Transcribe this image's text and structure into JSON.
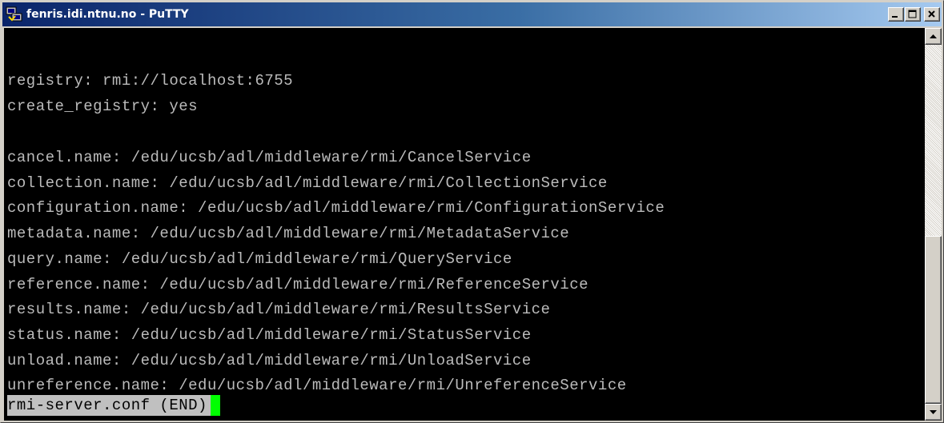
{
  "window": {
    "title": "fenris.idi.ntnu.no - PuTTY",
    "icon": "putty-icon",
    "controls": [
      "minimize-icon",
      "maximize-icon",
      "close-icon"
    ]
  },
  "terminal": {
    "lines": [
      "",
      "registry: rmi://localhost:6755",
      "create_registry: yes",
      "",
      "cancel.name: /edu/ucsb/adl/middleware/rmi/CancelService",
      "collection.name: /edu/ucsb/adl/middleware/rmi/CollectionService",
      "configuration.name: /edu/ucsb/adl/middleware/rmi/ConfigurationService",
      "metadata.name: /edu/ucsb/adl/middleware/rmi/MetadataService",
      "query.name: /edu/ucsb/adl/middleware/rmi/QueryService",
      "reference.name: /edu/ucsb/adl/middleware/rmi/ReferenceService",
      "results.name: /edu/ucsb/adl/middleware/rmi/ResultsService",
      "status.name: /edu/ucsb/adl/middleware/rmi/StatusService",
      "unload.name: /edu/ucsb/adl/middleware/rmi/UnloadService",
      "unreference.name: /edu/ucsb/adl/middleware/rmi/UnreferenceService"
    ],
    "status_line": "rmi-server.conf (END)",
    "colors": {
      "background": "#000000",
      "text": "#bbbbbb",
      "status_background": "#c0c0c0",
      "cursor": "#00ff00"
    }
  },
  "scrollbar": {
    "up_icon": "arrow-up-icon",
    "down_icon": "arrow-down-icon"
  }
}
